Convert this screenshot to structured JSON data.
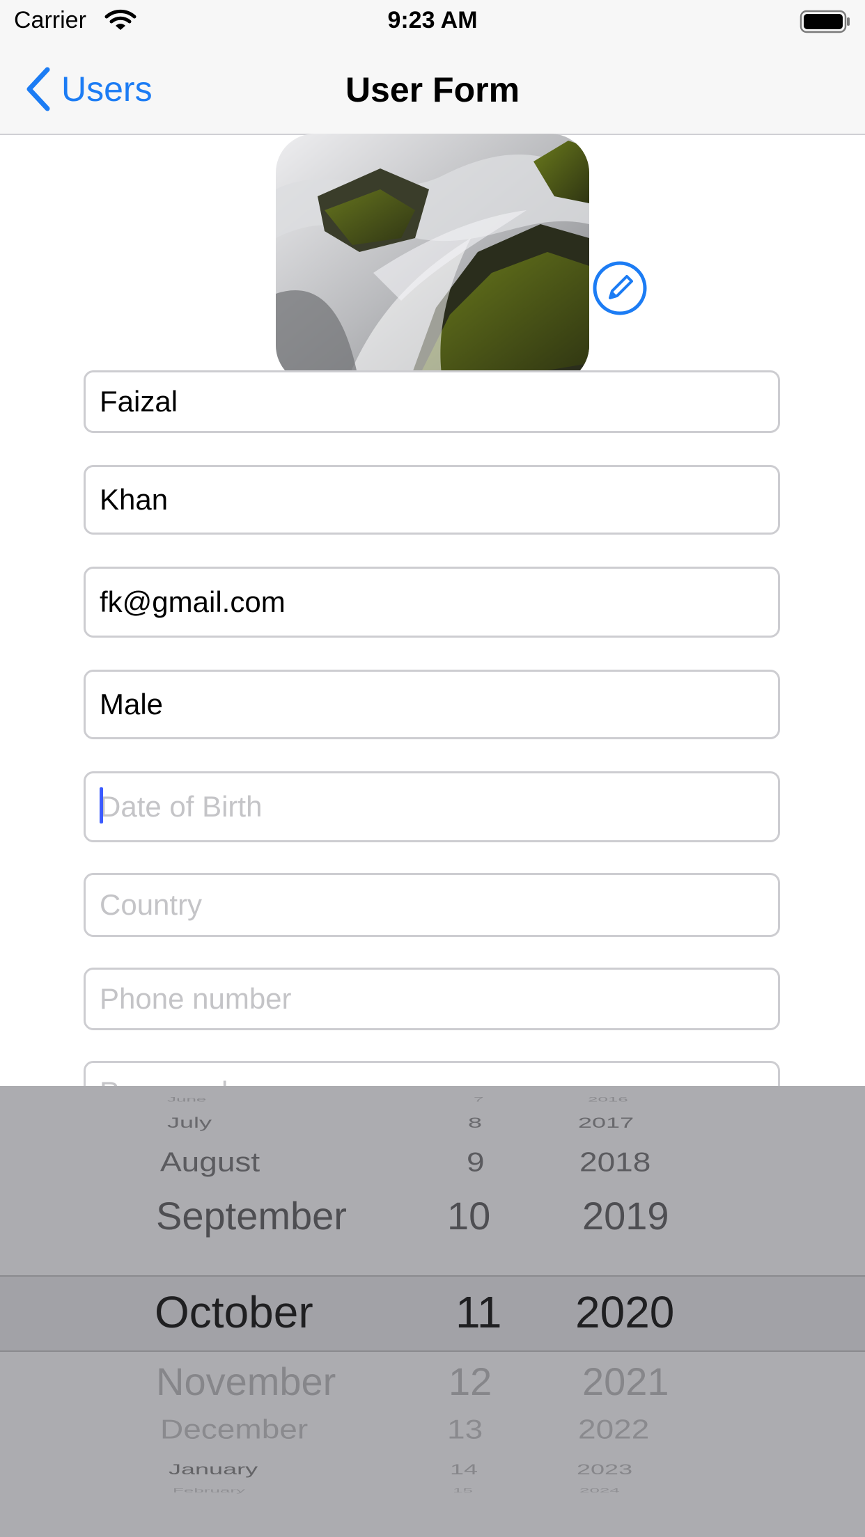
{
  "status_bar": {
    "carrier": "Carrier",
    "time": "9:23 AM"
  },
  "nav": {
    "back_label": "Users",
    "title": "User Form"
  },
  "form": {
    "first_name": {
      "value": "Faizal"
    },
    "last_name": {
      "value": "Khan"
    },
    "email": {
      "value": "fk@gmail.com"
    },
    "gender": {
      "value": "Male"
    },
    "dob": {
      "value": "",
      "placeholder": "Date of Birth"
    },
    "country": {
      "value": "",
      "placeholder": "Country"
    },
    "phone": {
      "value": "",
      "placeholder": "Phone number"
    },
    "password": {
      "value": "",
      "placeholder": "Password"
    }
  },
  "picker": {
    "months": [
      "June",
      "July",
      "August",
      "September",
      "October",
      "November",
      "December",
      "January",
      "February"
    ],
    "days": [
      "7",
      "8",
      "9",
      "10",
      "11",
      "12",
      "13",
      "14",
      "15"
    ],
    "years": [
      "2016",
      "2017",
      "2018",
      "2019",
      "2020",
      "2021",
      "2022",
      "2023",
      "2024"
    ],
    "selected": {
      "month": "October",
      "day": "11",
      "year": "2020"
    }
  },
  "icons": {
    "back": "chevron-left-icon",
    "wifi": "wifi-icon",
    "battery": "battery-icon",
    "edit": "pencil-circle-icon"
  },
  "colors": {
    "accent": "#1c7cf4",
    "caret": "#3b5bff",
    "picker_bg": "#acacb0"
  }
}
